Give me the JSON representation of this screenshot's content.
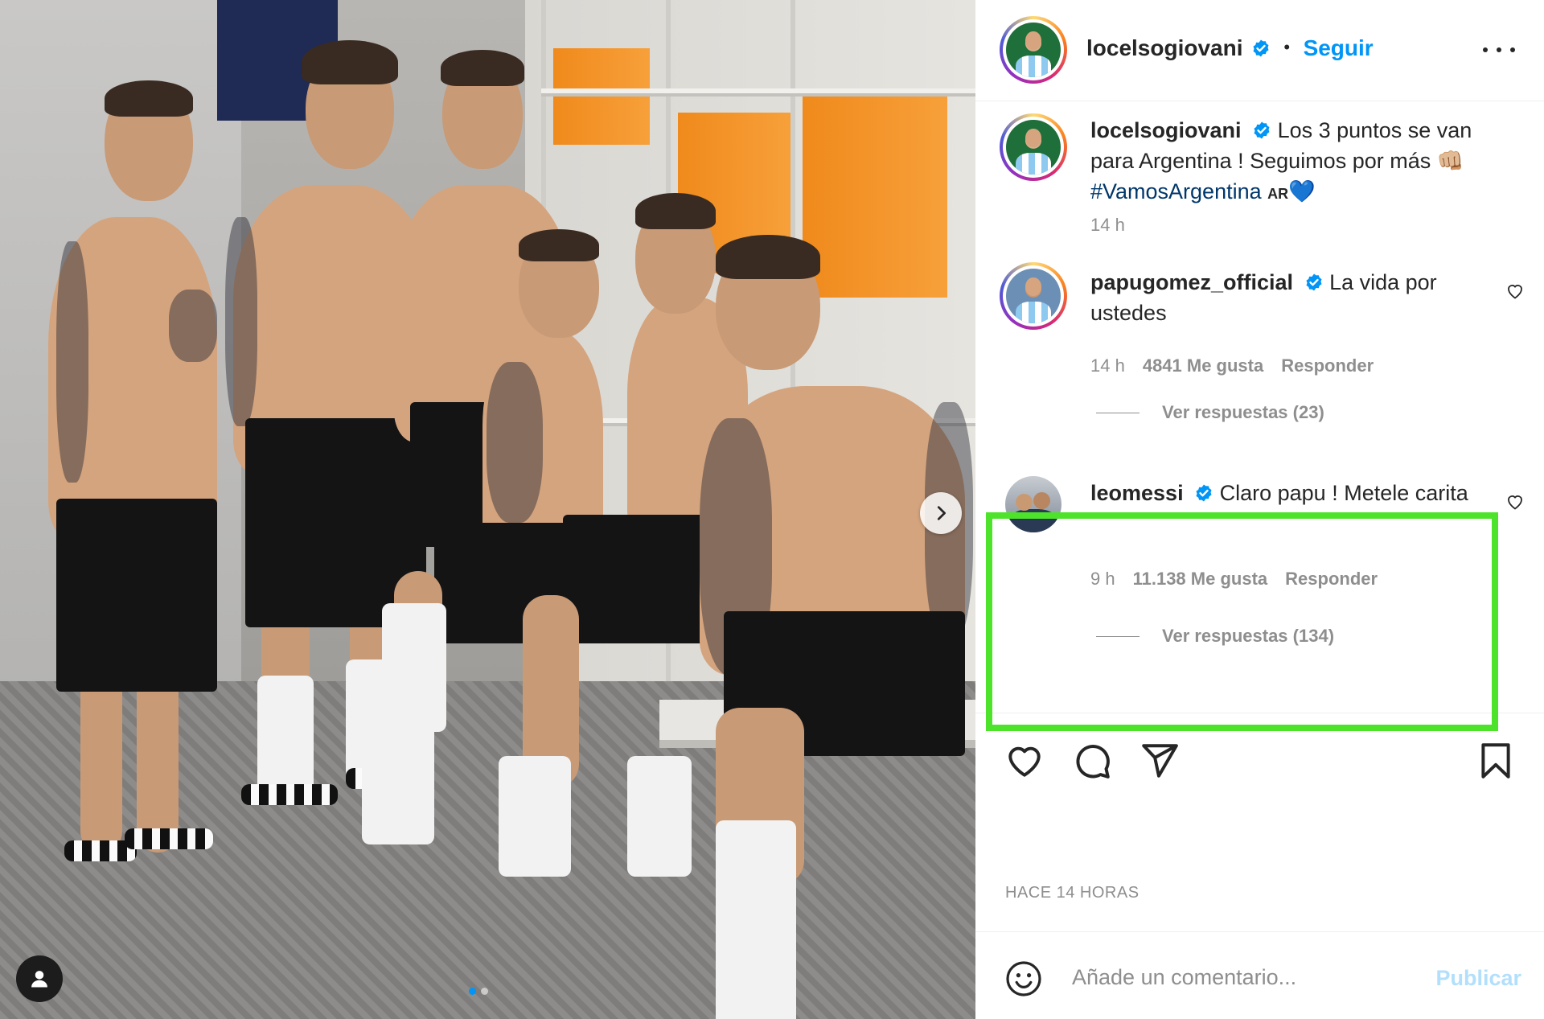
{
  "post": {
    "author": "locelsogiovani",
    "follow_label": "Seguir",
    "separator": "•",
    "caption_part1": "Los 3 puntos se van para Argentina ! Seguimos por más",
    "caption_emoji": "👊🏼",
    "caption_hashtag": "#VamosArgentina",
    "caption_flag": "AR",
    "caption_heart": "💙",
    "caption_time": "14 h",
    "posted_ago": "HACE 14 HORAS"
  },
  "comments": [
    {
      "username": "papugomez_official",
      "text": "La vida por ustedes",
      "time": "14 h",
      "likes": "4841 Me gusta",
      "reply_label": "Responder",
      "view_replies": "Ver respuestas (23)"
    },
    {
      "username": "leomessi",
      "text": "Claro papu ! Metele carita",
      "time": "9 h",
      "likes": "11.138 Me gusta",
      "reply_label": "Responder",
      "view_replies": "Ver respuestas (134)"
    }
  ],
  "composer": {
    "placeholder": "Añade un comentario...",
    "publish_label": "Publicar"
  },
  "carousel": {
    "slides": 2,
    "active": 1
  },
  "colors": {
    "accent": "#0095f6",
    "highlight": "#4ee32b",
    "publish_disabled": "#b2dffc",
    "muted": "#8e8e8e"
  },
  "icons": {
    "like": "heart-icon",
    "comment": "comment-icon",
    "share": "paper-plane-icon",
    "save": "bookmark-icon",
    "emoji": "emoji-icon",
    "next": "chevron-right-icon",
    "tags": "user-tag-icon",
    "more": "more-options-icon",
    "verified": "verified-badge-icon"
  }
}
